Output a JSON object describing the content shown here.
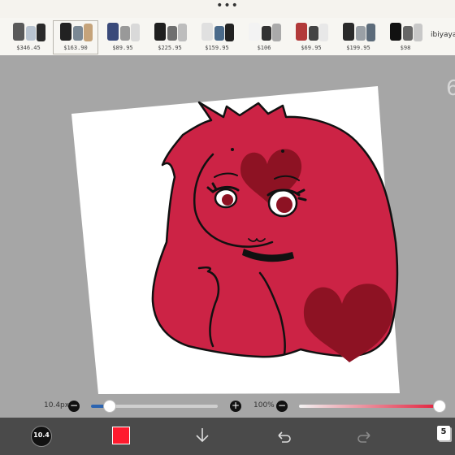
{
  "topbar": {
    "menu_glyph": "•••"
  },
  "ad_strip": {
    "items": [
      {
        "price": "$346.45",
        "selected": false
      },
      {
        "price": "$163.90",
        "selected": true
      },
      {
        "price": "$89.95",
        "selected": false
      },
      {
        "price": "$225.95",
        "selected": false
      },
      {
        "price": "$159.95",
        "selected": false
      },
      {
        "price": "$106",
        "selected": false
      },
      {
        "price": "$69.95",
        "selected": false
      },
      {
        "price": "$199.95",
        "selected": false
      },
      {
        "price": "$98",
        "selected": false
      }
    ],
    "brand": "ibiyaya"
  },
  "workspace": {
    "edge_glyph": "6"
  },
  "brush_size": {
    "label": "10.4px",
    "value_fraction": 0.14,
    "minus": "−",
    "plus": "+"
  },
  "opacity": {
    "label": "100%",
    "value_fraction": 1.0,
    "minus": "−",
    "plus": "+"
  },
  "toolbar": {
    "brush_badge": "10.4",
    "current_color": "#ff1a2e",
    "layers_count": "5"
  },
  "colors": {
    "workspace_bg": "#a6a6a6",
    "hair_red": "#cc2345",
    "heart_dark": "#8d1223",
    "toolbar_bg": "#4a4a4a",
    "slider_blue": "#2c64b0",
    "opacity_red": "#e3223e"
  }
}
